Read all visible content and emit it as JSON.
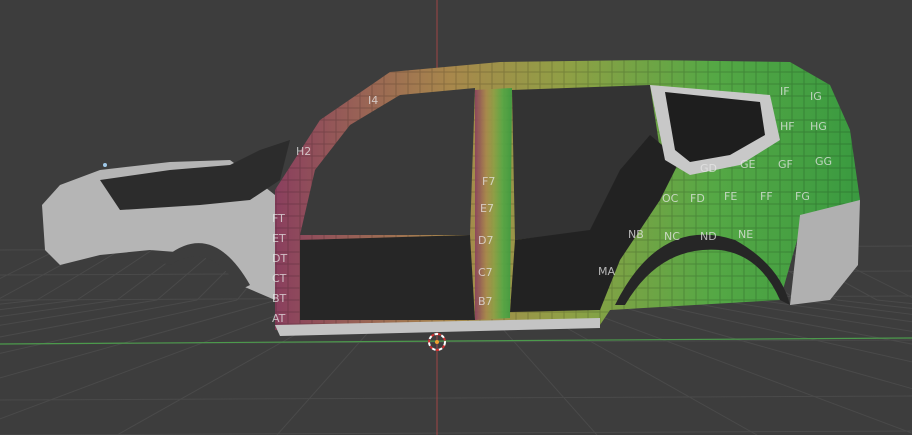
{
  "viewport": {
    "background": "#3d3d3d",
    "grid_color": "#4a4a4a",
    "x_axis_color": "#4c9a4c",
    "y_axis_color": "#a04545",
    "cursor_icon": "3d-cursor-icon"
  },
  "model": {
    "body_color": "#b9b9b9",
    "interior_color": "#2a2a2a",
    "texture_colors": [
      "#8a3f5e",
      "#b09050",
      "#6fa040",
      "#3f9a3f"
    ],
    "texture_labels": [
      "I4",
      "H2",
      "FT",
      "ET",
      "DT",
      "CT",
      "BT",
      "AT",
      "F7",
      "E7",
      "D7",
      "C7",
      "B7",
      "IF",
      "IG",
      "HF",
      "HG",
      "GD",
      "GE",
      "GF",
      "GG",
      "OC",
      "FD",
      "FE",
      "FF",
      "FG",
      "NB",
      "NC",
      "ND",
      "NE",
      "MA"
    ]
  }
}
